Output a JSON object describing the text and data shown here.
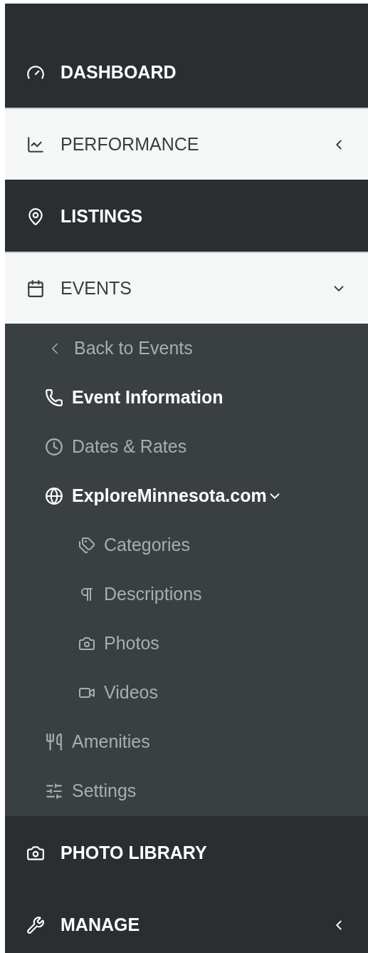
{
  "nav": [
    {
      "label": "DASHBOARD",
      "highlighted": false
    },
    {
      "label": "PERFORMANCE",
      "highlighted": true,
      "expanded": false
    },
    {
      "label": "LISTINGS",
      "highlighted": false
    },
    {
      "label": "EVENTS",
      "highlighted": true,
      "expanded": true,
      "children": [
        {
          "kind": "back",
          "label": "Back to Events"
        },
        {
          "kind": "link",
          "label": "Event Information",
          "active": true
        },
        {
          "kind": "link",
          "label": "Dates & Rates",
          "active": false
        },
        {
          "kind": "link",
          "label": "ExploreMinnesota.com",
          "active": true,
          "expanded": true,
          "children": [
            {
              "label": "Categories",
              "active": false
            },
            {
              "label": "Descriptions",
              "active": false
            },
            {
              "label": "Photos",
              "active": false
            },
            {
              "label": "Videos",
              "active": false
            }
          ]
        },
        {
          "kind": "link",
          "label": "Amenities",
          "active": false
        },
        {
          "kind": "link",
          "label": "Settings",
          "active": false
        }
      ]
    },
    {
      "label": "PHOTO LIBRARY",
      "highlighted": false
    },
    {
      "label": "MANAGE",
      "highlighted": false,
      "expanded": false
    }
  ]
}
